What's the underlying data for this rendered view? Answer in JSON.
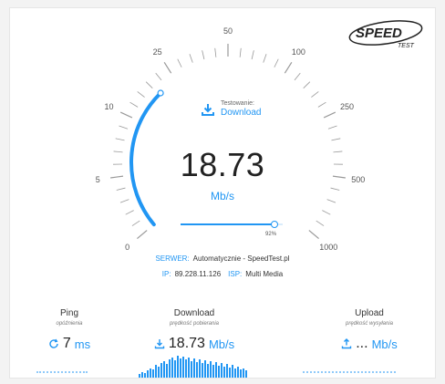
{
  "brand": {
    "logo_text": "SPEED",
    "logo_subtext": "TEST"
  },
  "gauge": {
    "scale_labels": [
      "0",
      "5",
      "10",
      "25",
      "50",
      "100",
      "250",
      "500",
      "1000"
    ],
    "fill_fraction": 0.33,
    "accent_color": "#2196f3"
  },
  "testing": {
    "label": "Testowanie:",
    "value": "Download",
    "icon": "download-icon"
  },
  "speed": {
    "value": "18.73",
    "unit": "Mb/s"
  },
  "progress": {
    "fraction": 0.92,
    "label": "92%"
  },
  "server": {
    "label": "SERWER:",
    "value": "Automatycznie - SpeedTest.pl"
  },
  "ip": {
    "label": "IP:",
    "value": "89.228.11.126",
    "isp_label": "ISP:",
    "isp_value": "Multi Media"
  },
  "stats": {
    "ping": {
      "title": "Ping",
      "subtitle": "opóźnienia",
      "value": "7",
      "unit": "ms",
      "icon": "refresh-icon"
    },
    "download": {
      "title": "Download",
      "subtitle": "prędkość pobierania",
      "value": "18.73",
      "unit": "Mb/s",
      "icon": "download-icon"
    },
    "upload": {
      "title": "Upload",
      "subtitle": "prędkość wysyłania",
      "value": "...",
      "unit": "Mb/s",
      "icon": "upload-icon"
    }
  }
}
